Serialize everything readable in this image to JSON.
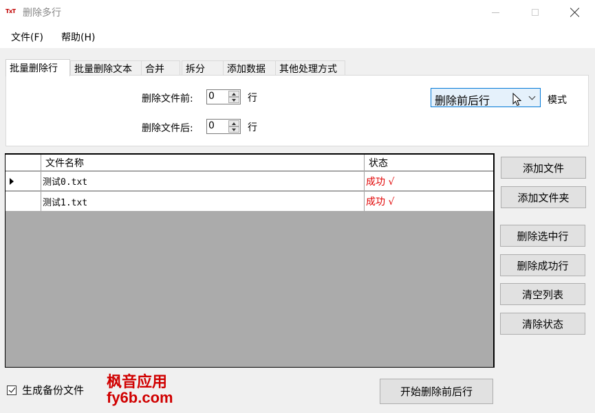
{
  "window": {
    "icon_text": "TxT",
    "title": "删除多行"
  },
  "menu": {
    "file": "文件(F)",
    "help": "帮助(H)"
  },
  "tabs": [
    {
      "label": "批量删除行",
      "active": true
    },
    {
      "label": "批量删除文本"
    },
    {
      "label": "合并"
    },
    {
      "label": "拆分"
    },
    {
      "label": "添加数据"
    },
    {
      "label": "其他处理方式"
    }
  ],
  "panel": {
    "delete_before_label": "删除文件前:",
    "delete_before_value": "0",
    "delete_after_label": "删除文件后:",
    "delete_after_value": "0",
    "unit": "行",
    "mode_value": "删除前后行",
    "mode_label": "模式"
  },
  "grid": {
    "columns": [
      "文件名称",
      "状态"
    ],
    "rows": [
      {
        "name": "测试0.txt",
        "status": "成功 √",
        "current": true
      },
      {
        "name": "测试1.txt",
        "status": "成功 √",
        "current": false
      }
    ]
  },
  "buttons": {
    "add_file": "添加文件",
    "add_folder": "添加文件夹",
    "delete_selected": "删除选中行",
    "delete_success": "删除成功行",
    "clear_list": "清空列表",
    "clear_status": "清除状态",
    "start": "开始删除前后行"
  },
  "backup": {
    "label": "生成备份文件",
    "checked": true
  },
  "watermark": {
    "line1": "枫音应用",
    "line2": "fy6b.com"
  },
  "colors": {
    "status_success": "#e00000",
    "watermark": "#d00000",
    "focus_border": "#0078d7"
  }
}
